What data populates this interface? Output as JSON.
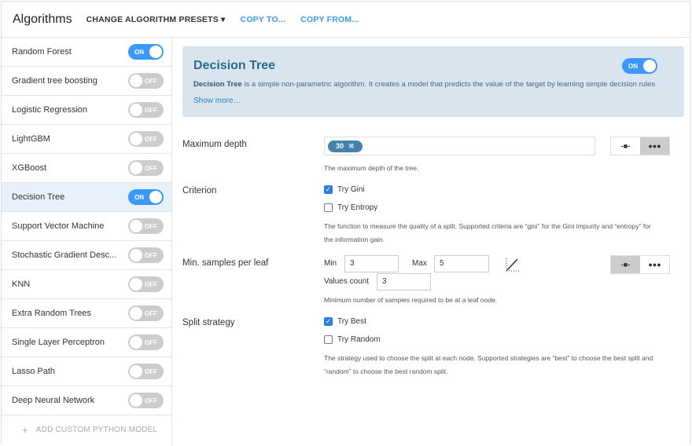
{
  "header": {
    "title": "Algorithms",
    "presets": "CHANGE ALGORITHM PRESETS",
    "presets_caret": "▾",
    "copy_to": "COPY TO...",
    "copy_from": "COPY FROM..."
  },
  "sidebar": {
    "items": [
      {
        "label": "Random Forest",
        "state": "ON"
      },
      {
        "label": "Gradient tree boosting",
        "state": "OFF"
      },
      {
        "label": "Logistic Regression",
        "state": "OFF"
      },
      {
        "label": "LightGBM",
        "state": "OFF"
      },
      {
        "label": "XGBoost",
        "state": "OFF"
      },
      {
        "label": "Decision Tree",
        "state": "ON"
      },
      {
        "label": "Support Vector Machine",
        "state": "OFF"
      },
      {
        "label": "Stochastic Gradient Desc...",
        "state": "OFF"
      },
      {
        "label": "KNN",
        "state": "OFF"
      },
      {
        "label": "Extra Random Trees",
        "state": "OFF"
      },
      {
        "label": "Single Layer Perceptron",
        "state": "OFF"
      },
      {
        "label": "Lasso Path",
        "state": "OFF"
      },
      {
        "label": "Deep Neural Network",
        "state": "OFF"
      }
    ],
    "add_icon": "+",
    "add_custom": "ADD CUSTOM PYTHON MODEL"
  },
  "banner": {
    "title": "Decision Tree",
    "state": "ON",
    "desc_bold": "Decision Tree",
    "desc": " is a simple non-parametric algorithm. It creates a model that predicts the value of the target by learning simple decision rules",
    "show_more": "Show more…"
  },
  "params": {
    "max_depth": {
      "label": "Maximum depth",
      "tag": "30",
      "tag_remove": "✖",
      "help": "The maximum depth of the tree."
    },
    "criterion": {
      "label": "Criterion",
      "options": [
        {
          "label": "Try Gini",
          "checked": true
        },
        {
          "label": "Try Entropy",
          "checked": false
        }
      ],
      "help1": "The function to measure the quality of a split. Supported criteria are “gini” for the Gini impurity and “entropy” for",
      "help2": "the information gain."
    },
    "min_samples": {
      "label": "Min. samples per leaf",
      "min_label": "Min",
      "min": "3",
      "max_label": "Max",
      "max": "5",
      "count_label": "Values count",
      "count": "3",
      "help": "Minimum number of samples required to be at a leaf node."
    },
    "split": {
      "label": "Split strategy",
      "options": [
        {
          "label": "Try Best",
          "checked": true
        },
        {
          "label": "Try Random",
          "checked": false
        }
      ],
      "help1": "The strategy used to choose the split at each node. Supported strategies are “best” to choose the best split and",
      "help2": "“random” to choose the best random split."
    }
  },
  "modes": {
    "explicit": "-■-",
    "range": "●●●"
  },
  "colors": {
    "accent": "#3b99fc",
    "banner": "#d9e5ee",
    "tag": "#4481ad"
  }
}
